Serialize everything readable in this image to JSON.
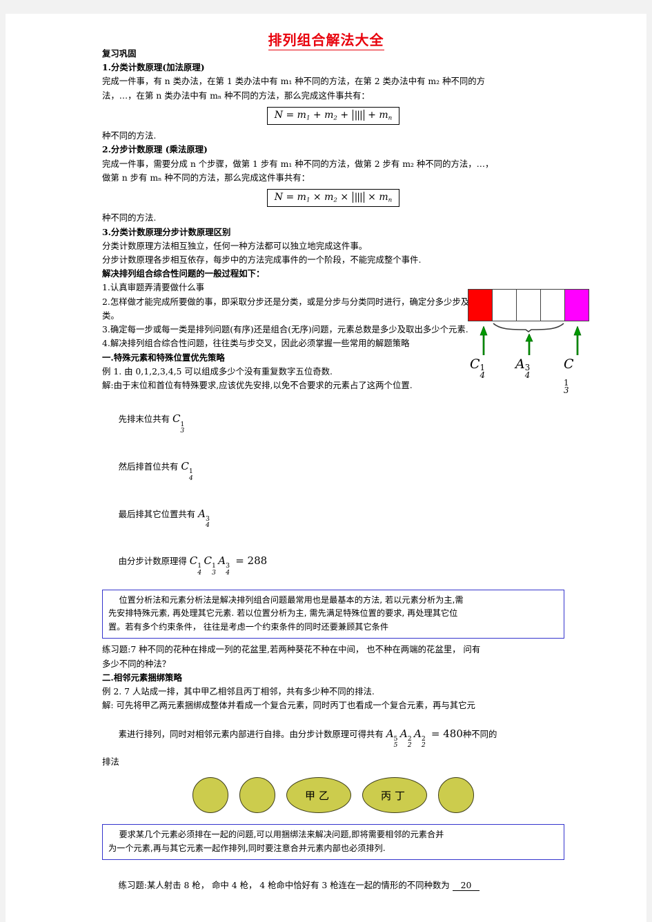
{
  "document": {
    "title": "排列组合解法大全 ",
    "section_review_heading": "复习巩固",
    "item1": {
      "heading": "1.分类计数原理(加法原理)",
      "body_line1": "完成一件事，有 n 类办法，在第 1 类办法中有 m₁ 种不同的方法，在第 2 类办法中有 m₂ 种不同的方",
      "body_line2": "法，…，在第 n 类办法中有 mₙ 种不同的方法，那么完成这件事共有：",
      "formula": "N = m₁ + m₂ + ⋯ + mₙ",
      "tail": "种不同的方法."
    },
    "item2": {
      "heading": "2.分步计数原理 (乘法原理)",
      "body_line1": "完成一件事，需要分成 n 个步骤，做第 1 步有 m₁ 种不同的方法，做第 2 步有 m₂ 种不同的方法，…，",
      "body_line2": "做第 n 步有 mₙ 种不同的方法，那么完成这件事共有：",
      "formula": "N = m₁ × m₂ × ⋯ × mₙ",
      "tail": "种不同的方法."
    },
    "item3": {
      "heading": "3.分类计数原理分步计数原理区别",
      "line1": "分类计数原理方法相互独立，任何一种方法都可以独立地完成这件事。",
      "line2": "分步计数原理各步相互依存，每步中的方法完成事件的一个阶段，不能完成整个事件."
    },
    "general_process_heading": "解决排列组合综合性问题的一般过程如下：",
    "steps": [
      "1.认真审题弄清要做什么事",
      "2.怎样做才能完成所要做的事，即采取分步还是分类，或是分步与分类同时进行，确定分多少步及多少",
      "类。",
      "3.确定每一步或每一类是排列问题(有序)还是组合(无序)问题，元素总数是多少及取出多少个元素.",
      "4.解决排列组合综合性问题，往往类与步交叉，因此必须掌握一些常用的解题策略"
    ],
    "strategy1": {
      "heading": "一.特殊元素和特殊位置优先策略",
      "example": "例 1. 由 0,1,2,3,4,5 可以组成多少个没有重复数字五位奇数.",
      "solution_intro": "解:由于末位和首位有特殊要求,应该优先安排,以免不合要求的元素占了这两个位置.",
      "steps": [
        {
          "text": "先排末位共有 ",
          "sym": "C",
          "sup": "1",
          "sub": "3"
        },
        {
          "text": "然后排首位共有 ",
          "sym": "C",
          "sup": "1",
          "sub": "4"
        },
        {
          "text": "最后排其它位置共有 ",
          "sym": "A",
          "sup": "3",
          "sub": "4"
        }
      ],
      "final_line_prefix": "由分步计数原理得 ",
      "final_result": " = 288",
      "diagram": {
        "cells": [
          "red",
          "white",
          "white",
          "white",
          "magenta"
        ],
        "arrow_labels": [
          {
            "sym": "C",
            "sup": "1",
            "sub": "4"
          },
          {
            "sym": "A",
            "sup": "3",
            "sub": "4"
          },
          {
            "sym": "C",
            "sup": "1",
            "sub": "3"
          }
        ],
        "arrow_color": "#009900",
        "cell_red": "#ff0000",
        "cell_magenta": "#ff00ff"
      },
      "callout": [
        "    位置分析法和元素分析法是解决排列组合问题最常用也是最基本的方法, 若以元素分析为主,需",
        "先安排特殊元素, 再处理其它元素. 若以位置分析为主, 需先满足特殊位置的要求, 再处理其它位",
        "置。若有多个约束条件， 往往是考虑一个约束条件的同时还要兼顾其它条件"
      ],
      "practice_line1": "练习题:7 种不同的花种在排成一列的花盆里,若两种葵花不种在中间， 也不种在两端的花盆里， 问有",
      "practice_line2": "多少不同的种法？"
    },
    "strategy2": {
      "heading": "二.相邻元素捆绑策略",
      "example": "例 2. 7 人站成一排，其中甲乙相邻且丙丁相邻，共有多少种不同的排法.",
      "solution_line1": "解: 可先将甲乙两元素捆绑成整体并看成一个复合元素，同时丙丁也看成一个复合元素，再与其它元",
      "solution_line2_prefix": "素进行排列，同时对相邻元素内部进行自排。由分步计数原理可得共有 ",
      "solution_line2_formula": " = 480",
      "solution_line2_suffix": "种不同的",
      "solution_line3": "排法",
      "ellipses": [
        "",
        "",
        "甲乙",
        "丙丁",
        ""
      ],
      "ellipse_color": "#cccc4d",
      "callout": [
        "    要求某几个元素必须排在一起的问题,可以用捆绑法来解决问题,即将需要相邻的元素合并",
        "为一个元素,再与其它元素一起作排列,同时要注意合并元素内部也必须排列."
      ],
      "practice_prefix": "练习题:某人射击 8 枪， 命中 4 枪， 4 枪命中恰好有 3 枪连在一起的情形的不同种数为 ",
      "practice_answer": "20"
    },
    "colors": {
      "title": "#e8000b",
      "callout_border": "#3333cc",
      "arrow_green": "#009900"
    }
  }
}
